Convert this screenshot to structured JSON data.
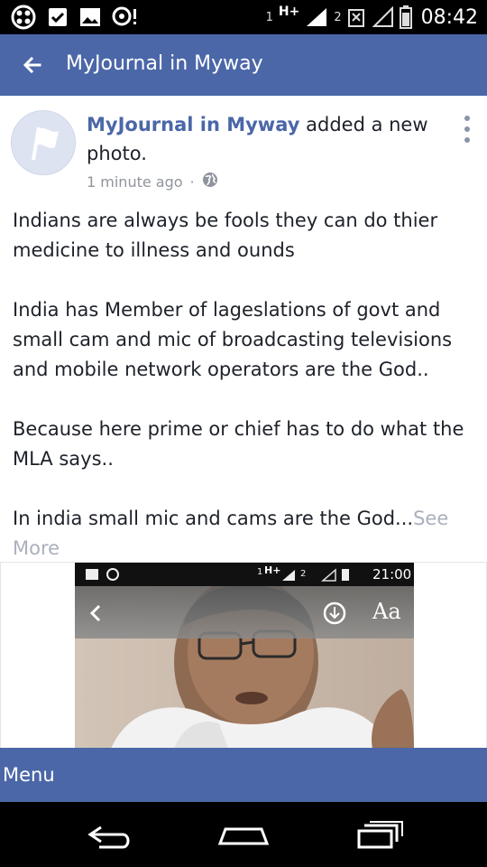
{
  "status_bar": {
    "sim1": "1",
    "network": "H+",
    "sim2": "2",
    "time": "08:42"
  },
  "app_bar": {
    "title": "MyJournal in Myway"
  },
  "post": {
    "author": "MyJournal in Myway",
    "action": "added a new photo.",
    "timestamp": "1 minute ago",
    "separator": "·",
    "paragraphs": [
      "Indians are always be fools they can do thier medicine to illness and ounds",
      "India has Member of lageslations of govt and small cam and mic of broadcasting televisions and mobile network operators are the God..",
      "Because here prime or chief has to do what the MLA says..",
      "In india small mic and cams are the God..."
    ],
    "see_more": "See More"
  },
  "photo": {
    "inner_status": {
      "sim1": "1",
      "network": "H+",
      "sim2": "2",
      "time": "21:00"
    },
    "reader_font_button": "Aa"
  },
  "menu_bar": {
    "label": "Menu"
  },
  "colors": {
    "brand_blue": "#4b67a8",
    "text": "#1d2129",
    "muted": "#90949c"
  }
}
